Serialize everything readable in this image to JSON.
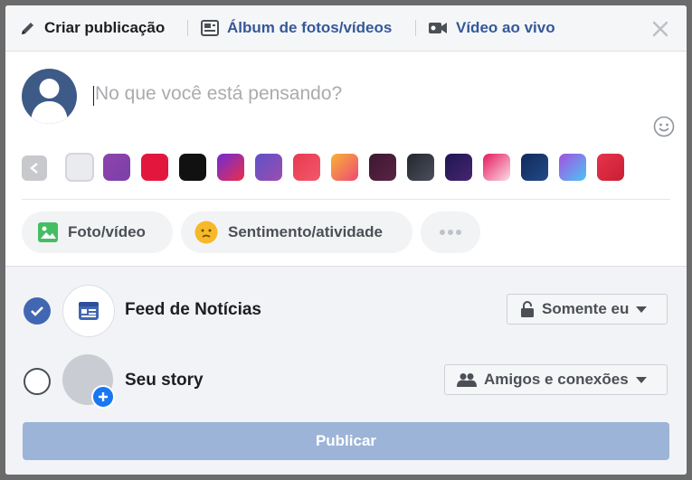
{
  "tabs": {
    "create_post": "Criar publicação",
    "photo_album": "Álbum de fotos/vídeos",
    "live_video": "Vídeo ao vivo"
  },
  "composer": {
    "placeholder": "No que você está pensando?",
    "background_swatches": [
      {
        "name": "white",
        "colors": [
          "#e9ebee",
          "#e9ebee"
        ]
      },
      {
        "name": "purple",
        "colors": [
          "#8e44ad",
          "#7b3fa8"
        ]
      },
      {
        "name": "red",
        "colors": [
          "#e3173e",
          "#e3173e"
        ]
      },
      {
        "name": "black",
        "colors": [
          "#111111",
          "#111111"
        ]
      },
      {
        "name": "purple-red",
        "colors": [
          "#6b2fd6",
          "#ee2c4b"
        ]
      },
      {
        "name": "violet",
        "colors": [
          "#5d52c9",
          "#9c4dae"
        ]
      },
      {
        "name": "hearts",
        "colors": [
          "#e8394f",
          "#f2596b"
        ]
      },
      {
        "name": "orange-pink",
        "colors": [
          "#f9b233",
          "#ed4a77"
        ]
      },
      {
        "name": "dark-plum",
        "colors": [
          "#3d1830",
          "#5a2446"
        ]
      },
      {
        "name": "slate",
        "colors": [
          "#23272f",
          "#4a505c"
        ]
      },
      {
        "name": "galaxy",
        "colors": [
          "#1f1753",
          "#46256f"
        ]
      },
      {
        "name": "pink-white",
        "colors": [
          "#e5185f",
          "#fbdde6"
        ]
      },
      {
        "name": "navy-city",
        "colors": [
          "#102a5c",
          "#234a86"
        ]
      },
      {
        "name": "purple-blue",
        "colors": [
          "#a64ee0",
          "#4cc5f5"
        ]
      },
      {
        "name": "crimson",
        "colors": [
          "#e6334a",
          "#c91f35"
        ]
      }
    ]
  },
  "actions": {
    "photo_video": "Foto/vídeo",
    "feeling_activity": "Sentimento/atividade"
  },
  "audience": {
    "news_feed": "Feed de Notícias",
    "news_feed_privacy": "Somente eu",
    "story": "Seu story",
    "story_privacy": "Amigos e conexões",
    "news_feed_checked": true,
    "story_checked": false
  },
  "publish_button": "Publicar",
  "colors": {
    "link_blue": "#365899",
    "check_blue": "#4267b2",
    "publish_disabled": "#9cb4d8",
    "photo_green": "#45bd62",
    "feeling_yellow": "#f7b928"
  }
}
